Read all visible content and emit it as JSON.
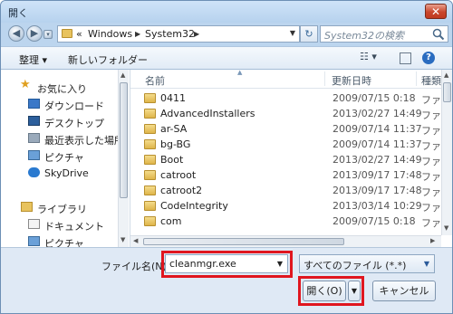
{
  "window": {
    "title": "開く",
    "close_glyph": "✕"
  },
  "address": {
    "back_glyph": "◀",
    "forward_glyph": "▶",
    "overflow": "«",
    "crumbs": [
      "Windows",
      "System32"
    ],
    "refresh_glyph": "↻",
    "search_placeholder": "System32の検索"
  },
  "toolbar": {
    "organize": "整理 ▾",
    "new_folder": "新しいフォルダー"
  },
  "nav": {
    "favorites_label": "お気に入り",
    "favorites": [
      {
        "label": "ダウンロード",
        "icon": "download-icon"
      },
      {
        "label": "デスクトップ",
        "icon": "desktop-icon"
      },
      {
        "label": "最近表示した場所",
        "icon": "recent-places-icon"
      },
      {
        "label": "ピクチャ",
        "icon": "pictures-icon"
      },
      {
        "label": "SkyDrive",
        "icon": "skydrive-icon"
      }
    ],
    "libraries_label": "ライブラリ",
    "libraries": [
      {
        "label": "ドキュメント",
        "icon": "documents-icon"
      },
      {
        "label": "ピクチャ",
        "icon": "pictures-icon"
      }
    ]
  },
  "columns": {
    "name": "名前",
    "date": "更新日時",
    "type": "種類"
  },
  "files": [
    {
      "name": "0411",
      "date": "2009/07/15 0:18",
      "type": "ファ"
    },
    {
      "name": "AdvancedInstallers",
      "date": "2013/02/27 14:49",
      "type": "ファ"
    },
    {
      "name": "ar-SA",
      "date": "2009/07/14 11:37",
      "type": "ファ"
    },
    {
      "name": "bg-BG",
      "date": "2009/07/14 11:37",
      "type": "ファ"
    },
    {
      "name": "Boot",
      "date": "2013/02/27 14:49",
      "type": "ファ"
    },
    {
      "name": "catroot",
      "date": "2013/09/17 17:48",
      "type": "ファ"
    },
    {
      "name": "catroot2",
      "date": "2013/09/17 17:48",
      "type": "ファ"
    },
    {
      "name": "CodeIntegrity",
      "date": "2013/03/14 10:29",
      "type": "ファ"
    },
    {
      "name": "com",
      "date": "2009/07/15 0:18",
      "type": "ファ"
    }
  ],
  "bottom": {
    "filename_label": "ファイル名(N):",
    "filename_value": "cleanmgr.exe",
    "filetype_value": "すべてのファイル (*.*)",
    "open_label": "開く(O)",
    "cancel_label": "キャンセル"
  },
  "colors": {
    "highlight": "#e0161f",
    "folder": "#e8c35e",
    "accent": "#bcd5ee"
  }
}
